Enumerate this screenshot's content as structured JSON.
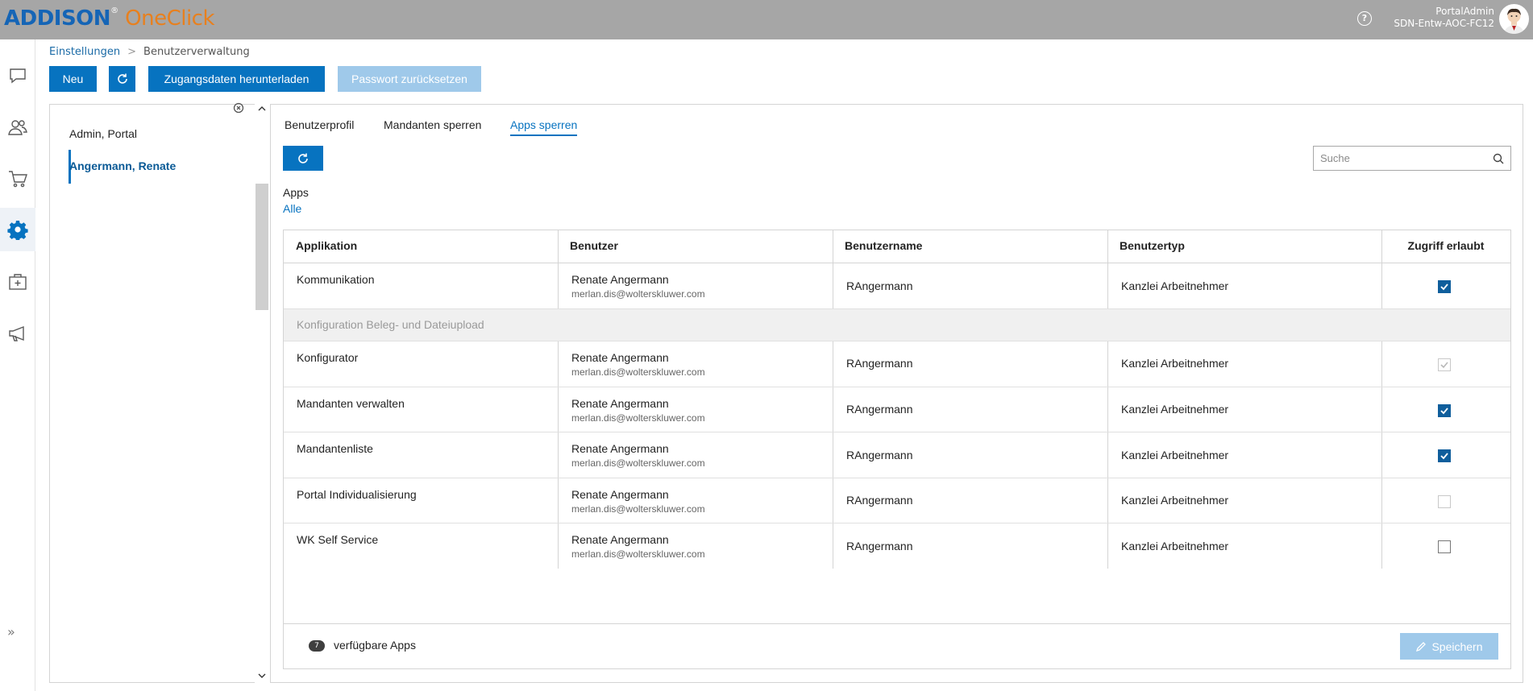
{
  "header": {
    "brand_part1": "ADDISON",
    "brand_reg": "®",
    "brand_part2": "OneClick",
    "help_label": "?",
    "user_name": "PortalAdmin",
    "user_host": "SDN-Entw-AOC-FC12"
  },
  "sidenav": {
    "items": [
      "chat-icon",
      "users-icon",
      "cart-icon",
      "gear-icon",
      "medkit-icon",
      "megaphone-icon"
    ],
    "active": "gear-icon",
    "expand_label": "»"
  },
  "breadcrumb": {
    "items": [
      "Einstellungen",
      "Benutzerverwaltung"
    ],
    "separator": ">"
  },
  "toolbar": {
    "new_label": "Neu",
    "download_label": "Zugangsdaten herunterladen",
    "reset_password_label": "Passwort zurücksetzen"
  },
  "user_list": {
    "items": [
      {
        "name": "Admin, Portal"
      },
      {
        "name": "Angermann, Renate"
      }
    ],
    "selected": "Angermann, Renate"
  },
  "tabs": [
    {
      "label": "Benutzerprofil"
    },
    {
      "label": "Mandanten sperren"
    },
    {
      "label": "Apps sperren"
    }
  ],
  "active_tab": "Apps sperren",
  "search": {
    "placeholder": "Suche"
  },
  "filter": {
    "label": "Apps",
    "value": "Alle"
  },
  "table": {
    "columns": [
      "Applikation",
      "Benutzer",
      "Benutzername",
      "Benutzertyp",
      "Zugriff erlaubt"
    ],
    "rows": [
      {
        "app": "Kommunikation",
        "user": "Renate Angermann",
        "email": "merlan.dis@wolterskluwer.com",
        "username": "RAngermann",
        "type": "Kanzlei Arbeitnehmer",
        "access": "checked"
      },
      {
        "group": "Konfiguration Beleg- und Dateiupload"
      },
      {
        "app": "Konfigurator",
        "user": "Renate Angermann",
        "email": "merlan.dis@wolterskluwer.com",
        "username": "RAngermann",
        "type": "Kanzlei Arbeitnehmer",
        "access": "checked-disabled"
      },
      {
        "app": "Mandanten verwalten",
        "user": "Renate Angermann",
        "email": "merlan.dis@wolterskluwer.com",
        "username": "RAngermann",
        "type": "Kanzlei Arbeitnehmer",
        "access": "checked"
      },
      {
        "app": "Mandantenliste",
        "user": "Renate Angermann",
        "email": "merlan.dis@wolterskluwer.com",
        "username": "RAngermann",
        "type": "Kanzlei Arbeitnehmer",
        "access": "checked"
      },
      {
        "app": "Portal Individualisierung",
        "user": "Renate Angermann",
        "email": "merlan.dis@wolterskluwer.com",
        "username": "RAngermann",
        "type": "Kanzlei Arbeitnehmer",
        "access": "unchecked-disabled"
      },
      {
        "app": "WK Self Service",
        "user": "Renate Angermann",
        "email": "merlan.dis@wolterskluwer.com",
        "username": "RAngermann",
        "type": "Kanzlei Arbeitnehmer",
        "access": "unchecked"
      }
    ]
  },
  "footer": {
    "count": "7",
    "count_label": "verfügbare Apps",
    "save_label": "Speichern"
  },
  "colors": {
    "primary": "#0773c0",
    "disabled": "#9fc9ea",
    "brand_blue": "#1565b6",
    "brand_orange": "#e8801e",
    "topbar": "#a6a6a6"
  }
}
